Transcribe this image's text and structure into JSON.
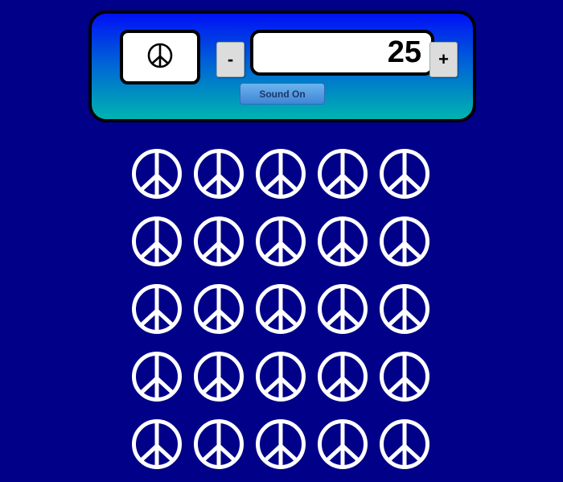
{
  "header": {
    "selected_symbol_icon": "peace-sign-icon",
    "decrement_label": "-",
    "increment_label": "+",
    "count_value": "25",
    "sound_button_label": "Sound On"
  },
  "grid": {
    "rows": 5,
    "columns": 5,
    "count": 25,
    "symbol_icon": "peace-sign-icon",
    "symbol_color": "#ffffff"
  },
  "colors": {
    "background": "#000088",
    "panel_gradient_top": "#0010f5",
    "panel_gradient_bottom": "#00b4b0"
  }
}
